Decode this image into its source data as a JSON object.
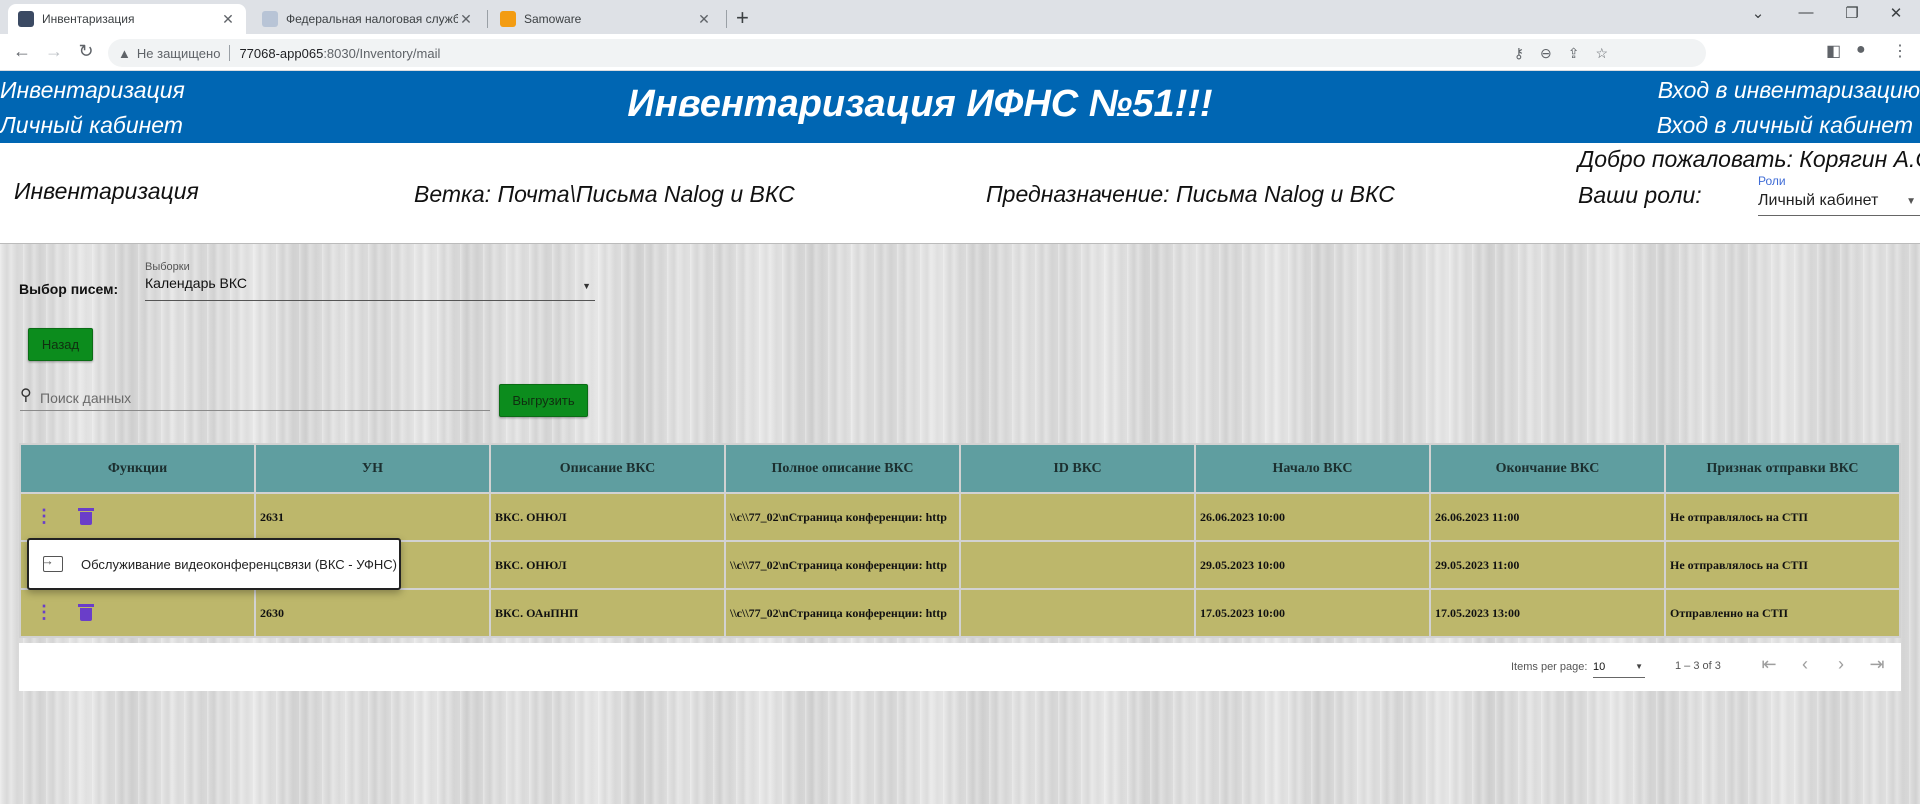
{
  "browser": {
    "tabs": [
      {
        "title": "Инвентаризация",
        "active": true
      },
      {
        "title": "Федеральная налоговая служба",
        "active": false
      },
      {
        "title": "Samoware",
        "active": false
      }
    ],
    "security_label": "Не защищено",
    "url_host": "77068-app065",
    "url_rest": ":8030/Inventory/mail"
  },
  "header": {
    "left_top": "Инвентаризация",
    "left_bottom": "Личный кабинет",
    "title": "Инвентаризация ИФНС №51!!!",
    "right_top": "Вход в инвентаризацию",
    "right_bottom": "Вход в личный кабинет"
  },
  "info": {
    "section": "Инвентаризация",
    "branch": "Ветка: Почта\\Письма Nalog и ВКС",
    "purpose": "Предназначение: Письма Nalog и ВКС",
    "welcome": "Добро пожаловать: Корягин А.С.",
    "roles_label": "Ваши роли:",
    "roles_field_label": "Роли",
    "roles_value": "Личный кабинет"
  },
  "filters": {
    "letters_label": "Выбор писем:",
    "selection_label": "Выборки",
    "selection_value": "Календарь ВКС"
  },
  "buttons": {
    "back": "Назад",
    "export": "Выгрузить"
  },
  "search": {
    "placeholder": "Поиск данных"
  },
  "table": {
    "headers": [
      "Функции",
      "УН",
      "Описание ВКС",
      "Полное описание ВКС",
      "ID ВКС",
      "Начало ВКС",
      "Окончание ВКС",
      "Признак отправки ВКС"
    ],
    "rows": [
      {
        "un": "2631",
        "desc": "ВКС. ОНЮЛ",
        "full": "\\\\c\\\\77_02\\nСтраница конференции: http",
        "id": "",
        "start": "26.06.2023 10:00",
        "end": "26.06.2023 11:00",
        "status": "Не отправлялось на СТП"
      },
      {
        "un": "",
        "desc": "ВКС. ОНЮЛ",
        "full": "\\\\c\\\\77_02\\nСтраница конференции: http",
        "id": "",
        "start": "29.05.2023 10:00",
        "end": "29.05.2023 11:00",
        "status": "Не отправлялось на СТП"
      },
      {
        "un": "2630",
        "desc": "ВКС. ОАнПНП",
        "full": "\\\\c\\\\77_02\\nСтраница конференции: http",
        "id": "",
        "start": "17.05.2023 10:00",
        "end": "17.05.2023 13:00",
        "status": "Отправленно на СТП"
      }
    ]
  },
  "popup_menu": {
    "item": "Обслуживание видеоконференцсвязи (ВКС - УФНС)"
  },
  "paginator": {
    "items_per_page_label": "Items per page:",
    "page_size": "10",
    "range": "1 – 3 of 3"
  },
  "colors": {
    "header_bg": "#0066b3",
    "table_header_bg": "#5f9ea0",
    "table_row_bg": "#bdb76b",
    "button_green": "#0c8c1d",
    "action_icon": "#6a3ec9"
  }
}
